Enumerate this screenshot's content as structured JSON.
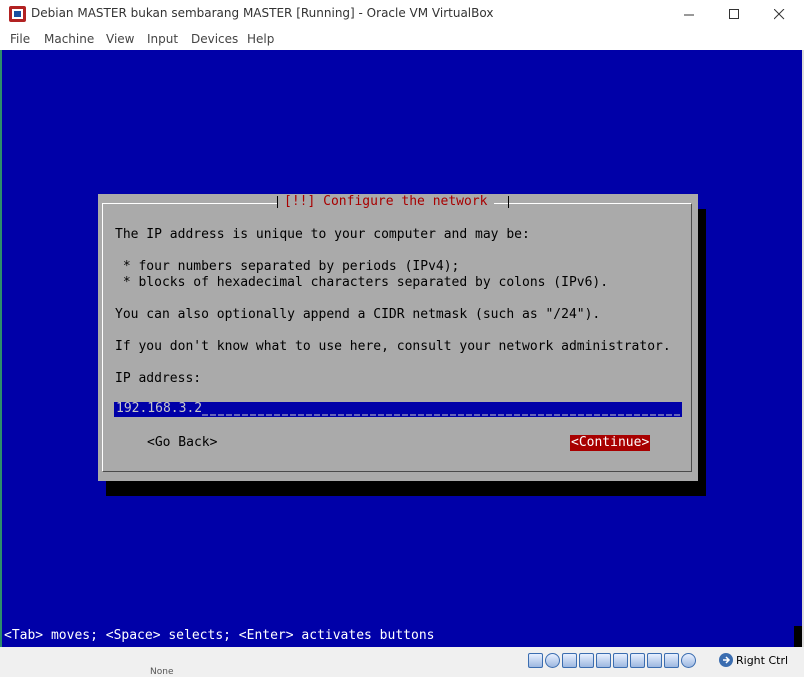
{
  "window": {
    "title": "Debian MASTER bukan sembarang MASTER [Running] - Oracle VM VirtualBox",
    "app_icon": "virtualbox-icon"
  },
  "menu": {
    "items": [
      "File",
      "Machine",
      "View",
      "Input",
      "Devices",
      "Help"
    ]
  },
  "installer": {
    "dialog_title": "[!!] Configure the network",
    "line1": "The IP address is unique to your computer and may be:",
    "bullet1": " * four numbers separated by periods (IPv4);",
    "bullet2": " * blocks of hexadecimal characters separated by colons (IPv6).",
    "line2": "You can also optionally append a CIDR netmask (such as \"/24\").",
    "line3": "If you don't know what to use here, consult your network administrator.",
    "field_label": "IP address:",
    "ip_value": "192.168.3.2",
    "go_back_label": "<Go Back>",
    "continue_label": "<Continue>",
    "help_text": "<Tab> moves; <Space> selects; <Enter> activates buttons"
  },
  "statusbar": {
    "host_key": "Right Ctrl",
    "stray_text": "None",
    "icons": [
      "hard-disk-icon",
      "optical-disk-icon",
      "audio-icon",
      "network-icon",
      "usb-icon",
      "shared-folders-icon",
      "display-icon",
      "video-capture-icon",
      "cpu-icon",
      "mouse-integration-icon",
      "host-key-icon"
    ]
  },
  "colors": {
    "vm_background": "#0000a8",
    "dialog_background": "#aaaaaa",
    "dialog_title": "#a80000",
    "continue_background": "#a80000"
  }
}
